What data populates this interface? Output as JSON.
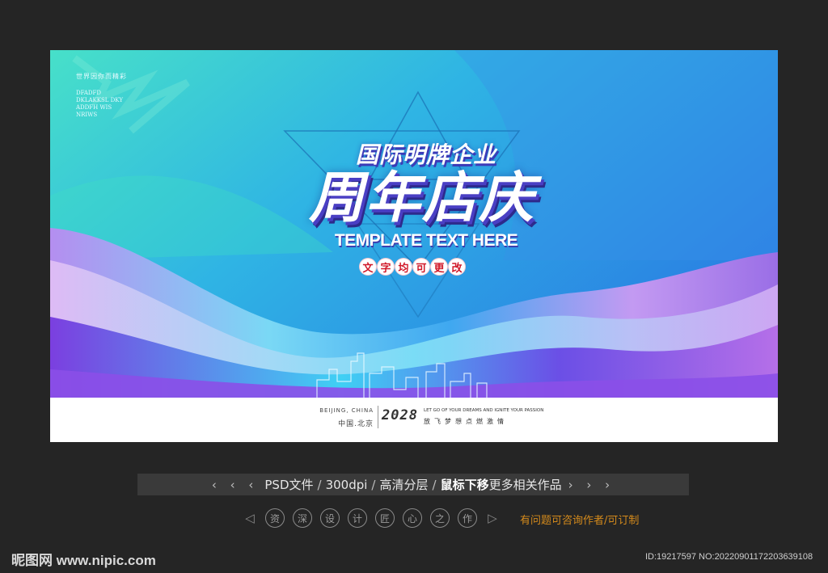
{
  "banner": {
    "tiny_cn": "世界因你而精彩",
    "tiny_en": [
      "DFADFD",
      "DKLAKKSL DKY",
      "ADDFH WIS",
      "NRIWS"
    ],
    "headline_small": "国际明牌企业",
    "headline_big": "周年店庆",
    "headline_en": "TEMPLATE TEXT HERE",
    "pills": [
      "文",
      "字",
      "均",
      "可",
      "更",
      "改"
    ],
    "footer": {
      "left_en": "BEIJING, CHINA",
      "left_cn": "中国.北京",
      "year": "2028",
      "right_en": "LET GO OF YOUR DREAMS AND IGNITE YOUR PASSION",
      "right_cn": "放飞梦想点燃激情"
    }
  },
  "toolbar": {
    "left_arrows": "‹ ‹ ‹",
    "psd": "PSD文件",
    "dpi": "300dpi",
    "layers": "高清分层",
    "mouse": "鼠标下移",
    "more": "更多相关作品",
    "right_arrows": "› › ›"
  },
  "menu": {
    "chars": [
      "资",
      "深",
      "设",
      "计",
      "匠",
      "心",
      "之",
      "作"
    ],
    "contact": "有问题可咨询作者/可订制"
  },
  "site": {
    "logo": "昵图网 www.nipic.com",
    "id": "ID:19217597 NO:20220901172203639108"
  },
  "colors": {
    "teal": "#3fd6c8",
    "blue": "#2f8be6",
    "purple": "#7a3fe0",
    "pink": "#d9a6f0",
    "accent_red": "#d11a2a",
    "contact_orange": "#d48a1c"
  }
}
